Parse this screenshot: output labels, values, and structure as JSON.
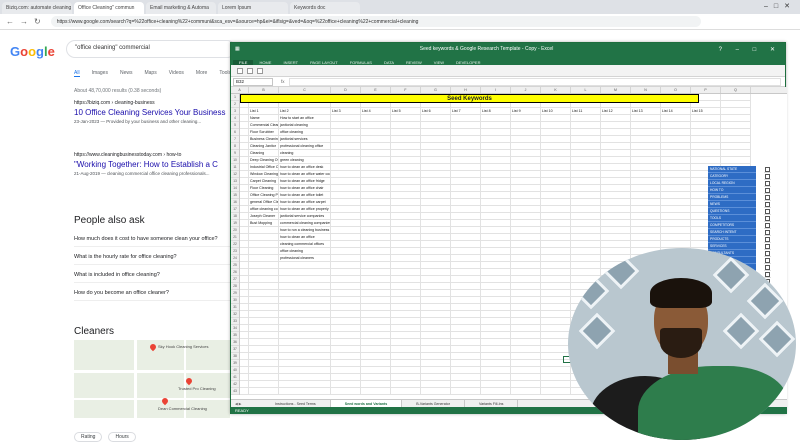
{
  "browser": {
    "tabs": [
      "Biziq.com: automate cleaning",
      "Office Cleaning\" commun",
      "Email marketing & Automa",
      "Lorem Ipsum",
      "Keywords doc"
    ],
    "url": "https://www.google.com/search?q=%22office+cleaning%22+communi&sca_esv=&source=hp&ei=&iflsig=&ved=&oq=%22office+cleaning%22+commercial+cleaning"
  },
  "google": {
    "query": "\"office cleaning\" commercial",
    "tabs": [
      "All",
      "Images",
      "News",
      "Maps",
      "Videos",
      "More",
      "Tools"
    ],
    "stats": "About 48,70,000 results (0.38 seconds)",
    "results": [
      {
        "source": "https://biziq.com › cleaning-business",
        "title": "10 Office Cleaning Services Your Business",
        "snippet": "23-Jan-2023 — Provided by your business and other cleaning..."
      },
      {
        "source": "https://www.cleaningbusinesstoday.com › how-to",
        "title": "\"Working Together: How to Establish a C",
        "snippet": "21-Aug-2019 — cleaning commercial office cleaning professionals..."
      }
    ],
    "people_also_ask": "People also ask",
    "questions": [
      "How much does it cost to have someone clean your office?",
      "What is the hourly rate for office cleaning?",
      "What is included in office cleaning?",
      "How do you become an office cleaner?"
    ],
    "cleaners_heading": "Cleaners",
    "map_labels": [
      "Sky Hook Cleaning Services",
      "Trusted Pro Cleaning",
      "Dean Commercial Cleaning"
    ],
    "chips": [
      "Rating",
      "Hours"
    ]
  },
  "excel": {
    "title": "Seed keywords & Google Research Template - Copy - Excel",
    "ribbon_tabs": [
      "FILE",
      "HOME",
      "INSERT",
      "PAGE LAYOUT",
      "FORMULAS",
      "DATA",
      "REVIEW",
      "VIEW",
      "DEVELOPER"
    ],
    "name_box": "B32",
    "banner": "Seed Keywords",
    "col_headers": [
      "A",
      "B",
      "C",
      "D",
      "E",
      "F",
      "G",
      "H",
      "I",
      "J",
      "K",
      "L",
      "M",
      "N",
      "O",
      "P",
      "Q"
    ],
    "header_row": [
      "List 1",
      "List 2",
      "List 3",
      "List 4",
      "List 5",
      "List 6",
      "List 7",
      "List 8",
      "List 9",
      "List 10",
      "List 11",
      "List 12",
      "List 13",
      "List 14",
      "List 15"
    ],
    "col_b": [
      "Name",
      "Commercial Cleaning",
      "Floor Scrubber",
      "Business Cleaning",
      "Cleaning Janitor",
      "Cleaning",
      "Deep Cleaning Office",
      "Industrial Office Cleaning",
      "Window Cleaning Office",
      "Carpet Cleaning",
      "Floor Cleaning",
      "Office Cleaning Pricing",
      "general Office Cleaning",
      "office cleaning company",
      "Joseph Cleaner",
      "Bust Mopping"
    ],
    "col_c": [
      "How to start an office",
      "janitorial cleaning",
      "office cleaning",
      "janitorial services",
      "professional cleaning office",
      "cleaning",
      "green cleaning",
      "how to clean an office desk",
      "how to clean an office water cooler",
      "how to clean an office fridge",
      "how to clean an office chair",
      "how to clean an office toilet",
      "how to clean an office carpet",
      "how to clean an office properly",
      "janitorial service companies",
      "commercial cleaning companies",
      "how to run a cleaning business",
      "how to clean an office",
      "cleaning commercial offices",
      "office cleaning",
      "professional cleaners"
    ],
    "side_list": [
      "NATIONAL STATE",
      "CATEGORY",
      "LOCAL REGION",
      "HOW TO",
      "PROBLEMS",
      "NEWS",
      "QUESTIONS",
      "TOOLS",
      "COMPETITORS",
      "SEARCH INTENT",
      "PRODUCTS",
      "SERVICES",
      "CONSULTANTS",
      "TRAINING",
      "EQUIPMENT",
      "JOBS",
      "LOCATIONS"
    ],
    "sheet_tabs": [
      "Instructions - Seed Terms",
      "Seed words and Variants",
      "B-Variants Generator",
      "Variants Fill-Ins"
    ],
    "status": "READY"
  },
  "webcam": {
    "description": "presenter webcam overlay"
  }
}
